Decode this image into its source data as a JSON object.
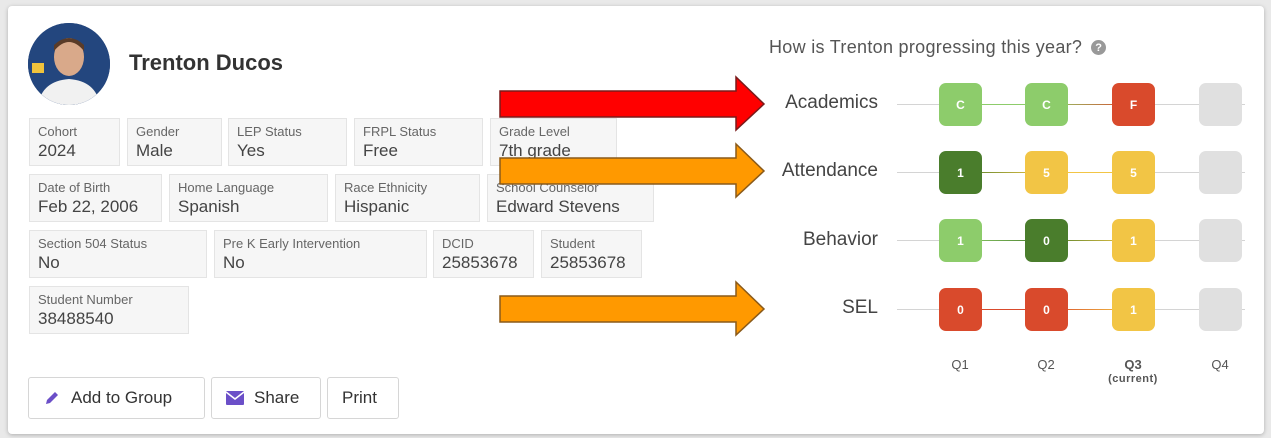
{
  "student": {
    "name": "Trenton Ducos"
  },
  "fields": [
    {
      "label": "Cohort",
      "value": "2024"
    },
    {
      "label": "Gender",
      "value": "Male"
    },
    {
      "label": "LEP Status",
      "value": "Yes"
    },
    {
      "label": "FRPL Status",
      "value": "Free"
    },
    {
      "label": "Grade Level",
      "value": "7th grade"
    },
    {
      "label": "Date of Birth",
      "value": "Feb 22, 2006"
    },
    {
      "label": "Home Language",
      "value": "Spanish"
    },
    {
      "label": "Race Ethnicity",
      "value": "Hispanic"
    },
    {
      "label": "School Counselor",
      "value": "Edward Stevens"
    },
    {
      "label": "Section 504 Status",
      "value": "No"
    },
    {
      "label": "Pre K Early Intervention",
      "value": "No"
    },
    {
      "label": "DCID",
      "value": "25853678"
    },
    {
      "label": "Student",
      "value": "25853678"
    },
    {
      "label": "Student Number",
      "value": "38488540"
    }
  ],
  "actions": {
    "add_to_group": "Add to Group",
    "share": "Share",
    "print": "Print"
  },
  "progress": {
    "question": "How is Trenton progressing this year?",
    "rows": [
      {
        "label": "Academics",
        "badges": [
          {
            "text": "C",
            "color": "#8dcc6b"
          },
          {
            "text": "C",
            "color": "#8dcc6b"
          },
          {
            "text": "F",
            "color": "#d94a2c"
          },
          {
            "text": "",
            "color": "#e0e0e0"
          }
        ]
      },
      {
        "label": "Attendance",
        "badges": [
          {
            "text": "1",
            "color": "#4a7d2c"
          },
          {
            "text": "5",
            "color": "#f2c545"
          },
          {
            "text": "5",
            "color": "#f2c545"
          },
          {
            "text": "",
            "color": "#e0e0e0"
          }
        ]
      },
      {
        "label": "Behavior",
        "badges": [
          {
            "text": "1",
            "color": "#8dcc6b"
          },
          {
            "text": "0",
            "color": "#4a7d2c"
          },
          {
            "text": "1",
            "color": "#f2c545"
          },
          {
            "text": "",
            "color": "#e0e0e0"
          }
        ]
      },
      {
        "label": "SEL",
        "badges": [
          {
            "text": "0",
            "color": "#d94a2c"
          },
          {
            "text": "0",
            "color": "#d94a2c"
          },
          {
            "text": "1",
            "color": "#f2c545"
          },
          {
            "text": "",
            "color": "#e0e0e0"
          }
        ]
      }
    ],
    "quarters": [
      {
        "label": "Q1",
        "note": ""
      },
      {
        "label": "Q2",
        "note": ""
      },
      {
        "label": "Q3",
        "note": "(current)"
      },
      {
        "label": "Q4",
        "note": ""
      }
    ]
  },
  "annotation_arrows": [
    {
      "points_to": "Academics",
      "color": "#ff0000"
    },
    {
      "points_to": "Attendance",
      "color": "#ff9900"
    },
    {
      "points_to": "SEL",
      "color": "#ff9900"
    }
  ]
}
